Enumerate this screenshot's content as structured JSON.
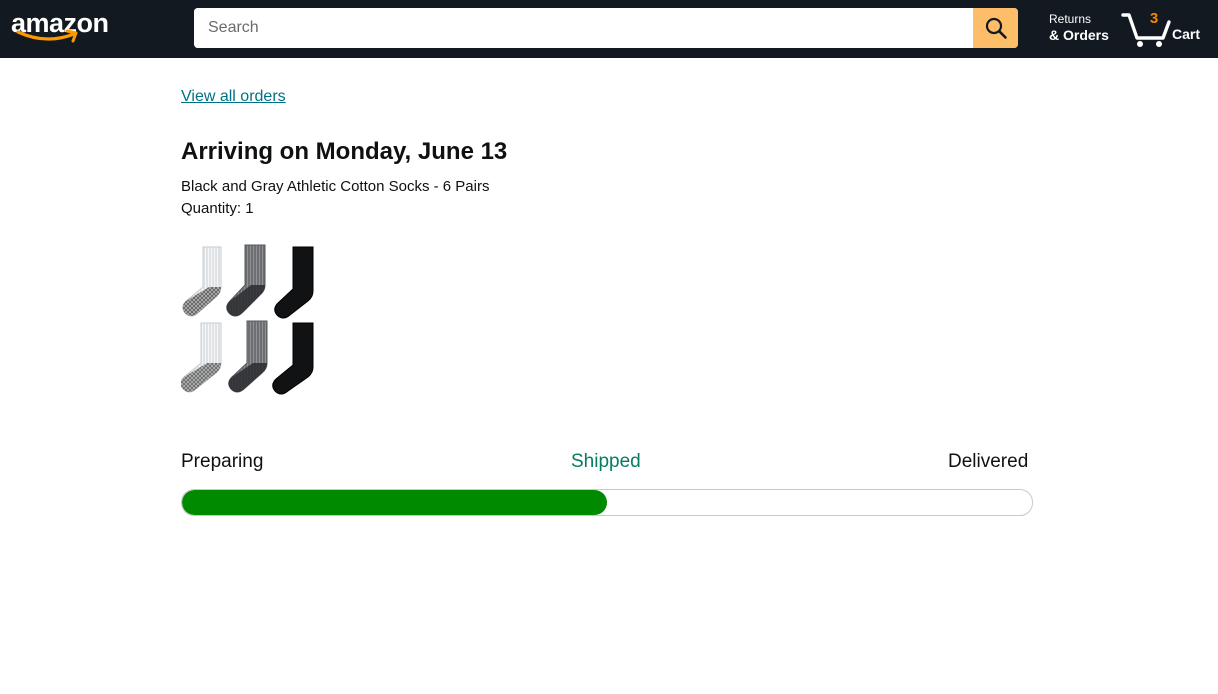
{
  "header": {
    "logo_text": "amazon",
    "search": {
      "placeholder": "Search",
      "value": ""
    },
    "returns_line1": "Returns",
    "returns_line2": "& Orders",
    "cart_count": "3",
    "cart_label": "Cart"
  },
  "order": {
    "view_all_link": "View all orders",
    "arrival_heading": "Arriving on Monday, June 13",
    "product_name": "Black and Gray Athletic Cotton Socks - 6 Pairs",
    "quantity_label": "Quantity: 1",
    "image_alt": "Black and Gray Athletic Cotton Socks - 6 Pairs"
  },
  "tracking": {
    "steps": [
      {
        "label": "Preparing",
        "state": "done"
      },
      {
        "label": "Shipped",
        "state": "current"
      },
      {
        "label": "Delivered",
        "state": "pending"
      }
    ],
    "progress_fraction": 0.5
  },
  "colors": {
    "header_bg": "#131921",
    "search_button": "#febd69",
    "link": "#007185",
    "progress_fill": "#008a00",
    "current_step": "#067d62",
    "cart_count": "#f08804"
  },
  "icons": {
    "search": "search-icon",
    "cart": "cart-icon"
  }
}
